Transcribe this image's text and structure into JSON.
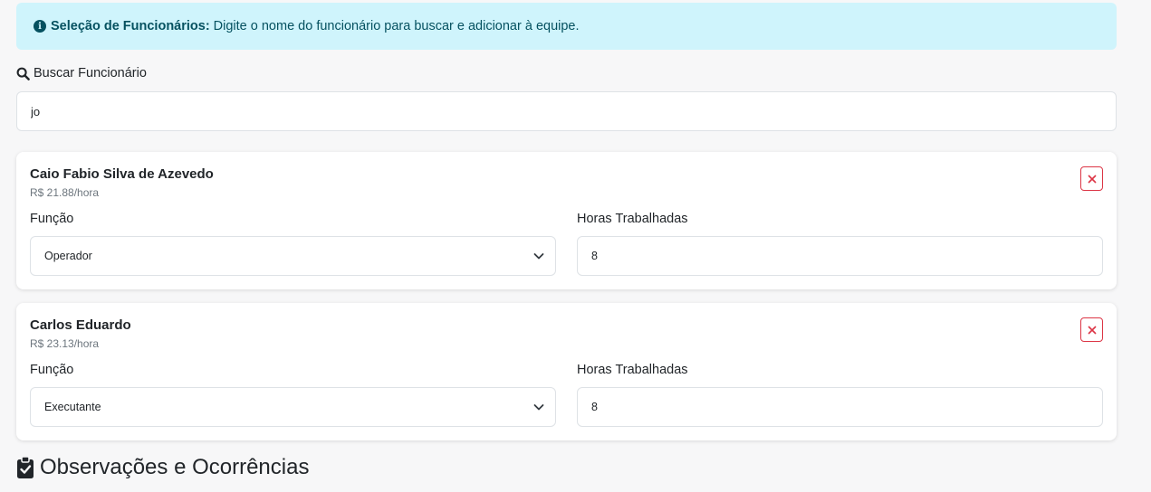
{
  "alert": {
    "title": "Seleção de Funcionários:",
    "message": "Digite o nome do funcionário para buscar e adicionar à equipe.",
    "icon": "info-icon"
  },
  "search": {
    "label": "Buscar Funcionário",
    "value": "jo",
    "icon": "search-icon"
  },
  "employees": [
    {
      "name": "Caio Fabio Silva de Azevedo",
      "rate": "R$ 21.88/hora",
      "role_label": "Função",
      "role_value": "Operador",
      "hours_label": "Horas Trabalhadas",
      "hours_value": "8"
    },
    {
      "name": "Carlos Eduardo",
      "rate": "R$ 23.13/hora",
      "role_label": "Função",
      "role_value": "Executante",
      "hours_label": "Horas Trabalhadas",
      "hours_value": "8"
    }
  ],
  "section": {
    "title": "Observações e Ocorrências",
    "icon": "clipboard-check-icon"
  },
  "colors": {
    "alert_bg": "#cff4fc",
    "alert_text": "#055160",
    "danger": "#dc3545"
  }
}
